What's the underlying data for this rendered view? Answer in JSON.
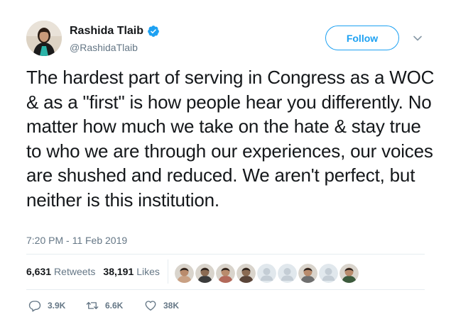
{
  "author": {
    "name": "Rashida Tlaib",
    "handle": "@RashidaTlaib",
    "verified": true
  },
  "follow_label": "Follow",
  "tweet": {
    "text": "The hardest part of serving in Congress as a WOC & as a \"first\" is how people hear you differently. No matter how much we take on the hate & stay true to who we are through our experiences, our voices are shushed and reduced. We aren't perfect, but neither is this institution.",
    "timestamp": "7:20 PM - 11 Feb 2019"
  },
  "stats": {
    "retweets_count": "6,631",
    "retweets_label": "Retweets",
    "likes_count": "38,191",
    "likes_label": "Likes"
  },
  "liked_by_avatars": [
    {
      "kind": "photo",
      "color": "#c9a184"
    },
    {
      "kind": "photo",
      "color": "#3b3b3b"
    },
    {
      "kind": "photo",
      "color": "#b3695a"
    },
    {
      "kind": "photo",
      "color": "#5a4438"
    },
    {
      "kind": "default",
      "color": "#c4cdd5"
    },
    {
      "kind": "default",
      "color": "#c4cdd5"
    },
    {
      "kind": "photo",
      "color": "#6f6f6f"
    },
    {
      "kind": "default",
      "color": "#c4cdd5"
    },
    {
      "kind": "photo",
      "color": "#3c5a3c"
    }
  ],
  "actions": {
    "replies": "3.9K",
    "retweets": "6.6K",
    "likes": "38K"
  },
  "colors": {
    "accent": "#1da1f2",
    "text": "#14171a",
    "muted": "#657786",
    "divider": "#e6ecf0"
  }
}
